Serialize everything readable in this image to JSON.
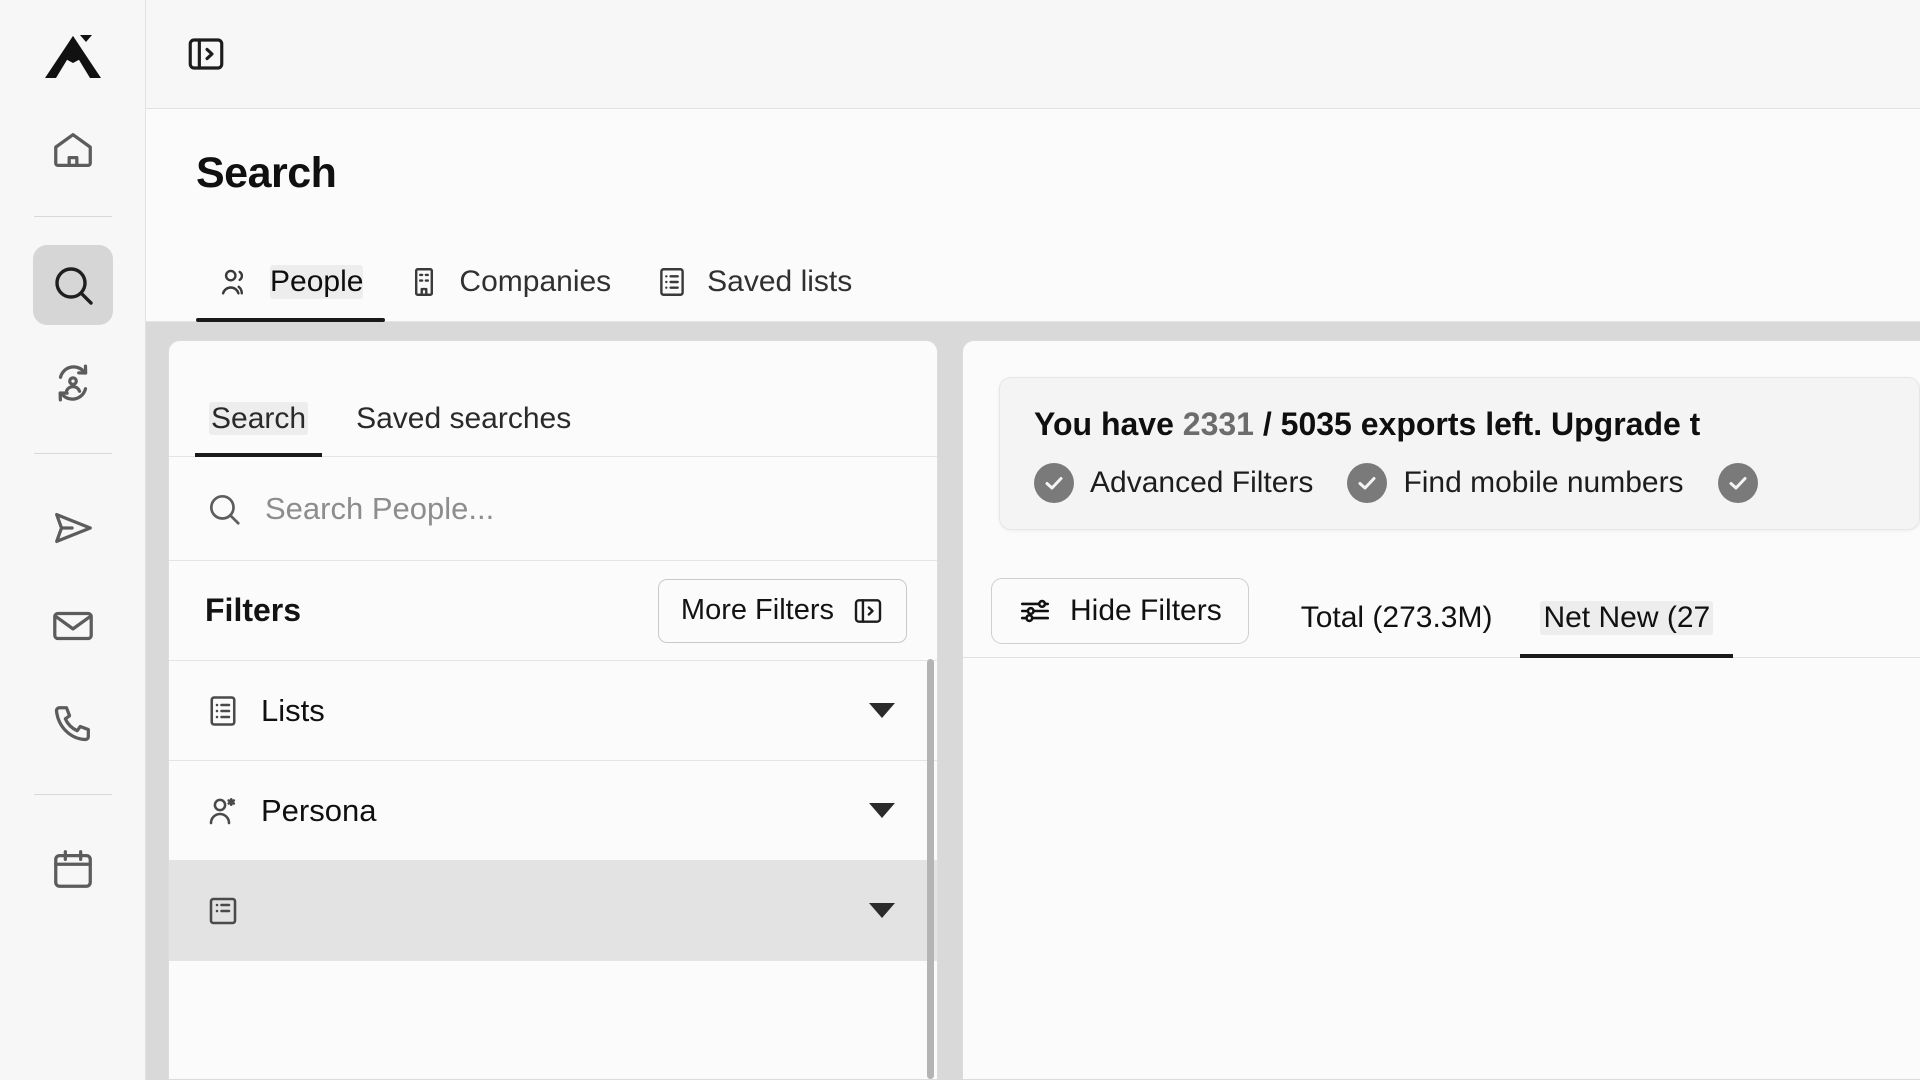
{
  "app": {
    "logo_name": "brand-logo"
  },
  "rail": {
    "items": [
      {
        "icon": "home-icon",
        "name": "home",
        "active": false
      },
      {
        "icon": "search-icon",
        "name": "search",
        "active": true
      },
      {
        "icon": "sync-contacts-icon",
        "name": "enrich",
        "active": false
      },
      {
        "icon": "send-icon",
        "name": "sequences",
        "active": false
      },
      {
        "icon": "mail-icon",
        "name": "emails",
        "active": false
      },
      {
        "icon": "phone-icon",
        "name": "calls",
        "active": false
      },
      {
        "icon": "calendar-icon",
        "name": "meetings",
        "active": false
      }
    ]
  },
  "topbar": {
    "panel_toggle_icon": "panel-expand-icon"
  },
  "page": {
    "title": "Search",
    "tabs": [
      {
        "label": "People",
        "icon": "people-icon",
        "active": true
      },
      {
        "label": "Companies",
        "icon": "building-icon",
        "active": false
      },
      {
        "label": "Saved lists",
        "icon": "list-icon",
        "active": false
      }
    ]
  },
  "filter_panel": {
    "tabs": [
      {
        "label": "Search",
        "active": true
      },
      {
        "label": "Saved searches",
        "active": false
      }
    ],
    "search_placeholder": "Search People...",
    "search_icon": "search-icon",
    "filters_title": "Filters",
    "more_filters_label": "More Filters",
    "more_filters_icon": "panel-expand-icon",
    "items": [
      {
        "label": "Lists",
        "icon": "list-icon",
        "highlighted": false
      },
      {
        "label": "Persona",
        "icon": "persona-icon",
        "highlighted": false
      },
      {
        "label": "",
        "icon": "grid-icon",
        "highlighted": true
      }
    ]
  },
  "content": {
    "banner": {
      "prefix": "You have ",
      "used": "2331",
      "separator": " / ",
      "total": "5035",
      "suffix": " exports left. Upgrade t",
      "features": [
        {
          "label": "Advanced Filters",
          "icon": "check-circle-icon"
        },
        {
          "label": "Find mobile numbers",
          "icon": "check-circle-icon"
        },
        {
          "label": "",
          "icon": "check-circle-icon"
        }
      ]
    },
    "toolbar": {
      "hide_filters_label": "Hide Filters",
      "hide_filters_icon": "sliders-icon",
      "tabs": [
        {
          "label": "Total (273.3M)",
          "active": false
        },
        {
          "label": "Net New (27",
          "active": true
        }
      ]
    }
  },
  "colors": {
    "accent": "#1a1a1a",
    "rail_bg": "#f7f7f7",
    "active_pill": "#d6d6d6",
    "muted_text": "#8d8d8d",
    "split_bg": "#d9d9d9"
  }
}
